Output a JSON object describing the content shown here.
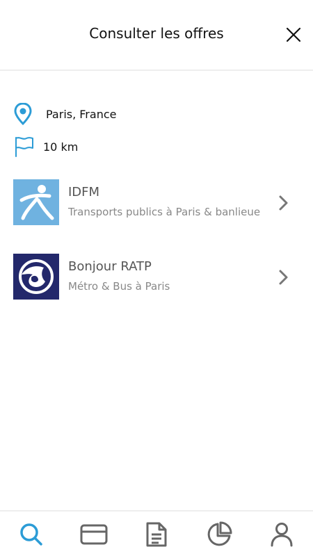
{
  "header": {
    "title": "Consulter les offres"
  },
  "filters": {
    "location": "Paris, France",
    "radius": "10 km"
  },
  "offers": [
    {
      "name": "IDFM",
      "subtitle": "Transports publics à Paris & banlieue"
    },
    {
      "name": "Bonjour RATP",
      "subtitle": "Métro & Bus à Paris"
    }
  ],
  "colors": {
    "accent": "#2c9cd6",
    "idfm_bg": "#6fb2e0",
    "ratp_bg": "#23286b",
    "icon_gray": "#666666"
  },
  "tabbar": {
    "active": "search",
    "icons": [
      "search-icon",
      "card-icon",
      "document-icon",
      "pie-chart-icon",
      "user-icon"
    ]
  }
}
